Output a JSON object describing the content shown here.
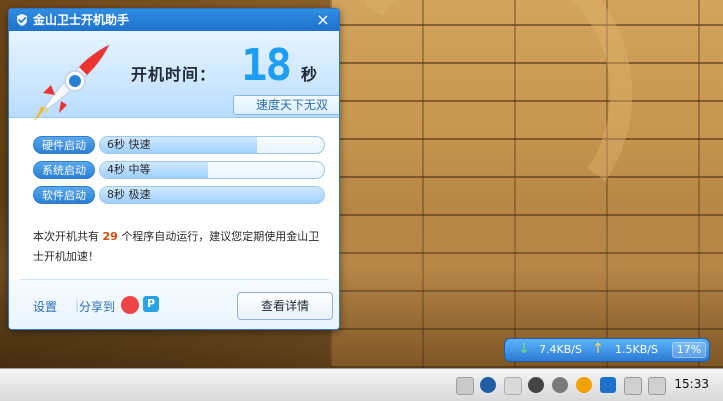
{
  "window": {
    "title": "金山卫士开机助手",
    "close_label": "×"
  },
  "header": {
    "boot_time_label": "开机时间：",
    "boot_time_seconds": "18",
    "seconds_unit": "秒",
    "speed_badge": "速度天下无双"
  },
  "rows": [
    {
      "tag": "硬件启动",
      "value": "6秒 快速",
      "fill_fraction": 0.7
    },
    {
      "tag": "系统启动",
      "value": "4秒 中等",
      "fill_fraction": 0.48
    },
    {
      "tag": "软件启动",
      "value": "8秒 极速",
      "fill_fraction": 1.0
    }
  ],
  "message": {
    "prefix": "本次开机共有",
    "count": "29",
    "suffix": "个程序自动运行，建议您定期使用金山卫士开机加速！"
  },
  "footer": {
    "settings": "设置",
    "separator": "|",
    "share_to": "分享到",
    "details_button": "查看详情"
  },
  "net_widget": {
    "down_speed": "7.4KB/S",
    "up_speed": "1.5KB/S",
    "cpu_percent": "17%"
  },
  "taskbar": {
    "clock": "15:33"
  },
  "icons": {
    "window_logo": "kingsoft-shield-icon",
    "rocket": "rocket-icon",
    "weibo": "weibo-icon",
    "qzone": "qzone-icon",
    "down_arrow": "download-arrow-icon",
    "up_arrow": "upload-arrow-icon"
  },
  "colors": {
    "titlebar": "#1f72cb",
    "digits": "#1e9ef2",
    "tag": "#2a7fd3",
    "highlight_number": "#d24a00"
  }
}
